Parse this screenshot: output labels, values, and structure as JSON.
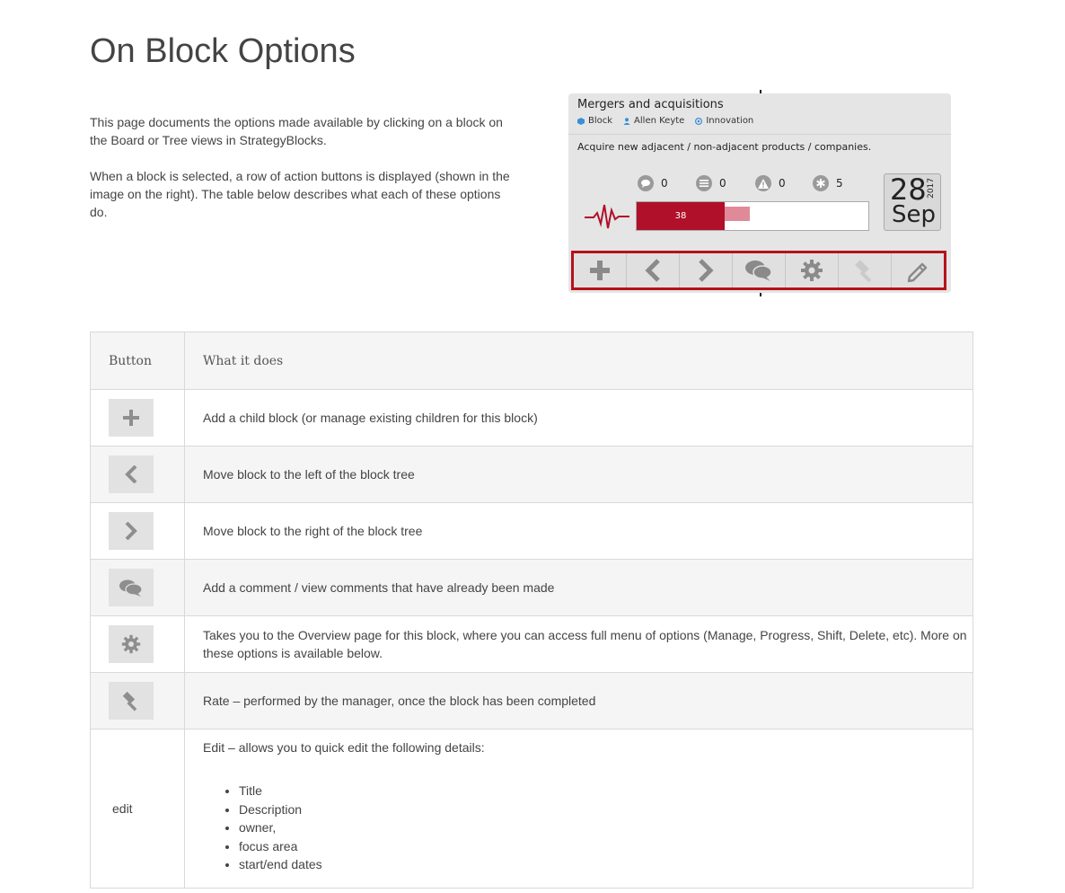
{
  "page": {
    "title": "On Block Options",
    "intro": [
      "This page documents the options made available by clicking on a block on the Board or Tree views in StrategyBlocks.",
      "When a block is selected, a row of action buttons is displayed (shown in the image on the right). The table below describes what each of these options do."
    ]
  },
  "block_card": {
    "title": "Mergers and acquisitions",
    "type_label": "Block",
    "owner": "Allen Keyte",
    "focus_area": "Innovation",
    "description": "Acquire new adjacent / non-adjacent products / companies.",
    "stats": [
      {
        "icon": "comments-icon",
        "value": "0"
      },
      {
        "icon": "list-icon",
        "value": "0"
      },
      {
        "icon": "warning-icon",
        "value": "0"
      },
      {
        "icon": "asterisk-icon",
        "value": "5"
      }
    ],
    "progress": {
      "label": "38",
      "actual_fraction": 0.38,
      "expected_fraction": 0.49
    },
    "date": {
      "day": "28",
      "month": "Sep",
      "year": "2017"
    },
    "actions": [
      "add-icon",
      "chevron-left-icon",
      "chevron-right-icon",
      "comments-icon",
      "gear-icon",
      "gavel-icon",
      "pencil-icon"
    ],
    "colors": {
      "accent": "#b0102a",
      "highlight_border": "#b4121c"
    }
  },
  "table": {
    "headers": [
      "Button",
      "What it does"
    ],
    "rows": [
      {
        "icon": "add-icon",
        "text": "Add a child block (or manage existing children for this block)"
      },
      {
        "icon": "chevron-left-icon",
        "text": "Move block to the left of the block tree"
      },
      {
        "icon": "chevron-right-icon",
        "text": "Move block to the right of the block tree"
      },
      {
        "icon": "comments-icon",
        "text": "Add a comment / view comments that have already been made"
      },
      {
        "icon": "gear-icon",
        "text": "Takes you to the Overview page for this block, where you can access full menu of options (Manage, Progress, Shift, Delete, etc). More on these options is available below."
      },
      {
        "icon": "gavel-icon",
        "text": "Rate – performed by the manager, once the block has been completed"
      }
    ],
    "edit_row": {
      "button": "edit",
      "text": "Edit – allows you to quick edit the following details:",
      "items": [
        "Title",
        "Description",
        "owner,",
        "focus area",
        "start/end dates"
      ]
    }
  }
}
